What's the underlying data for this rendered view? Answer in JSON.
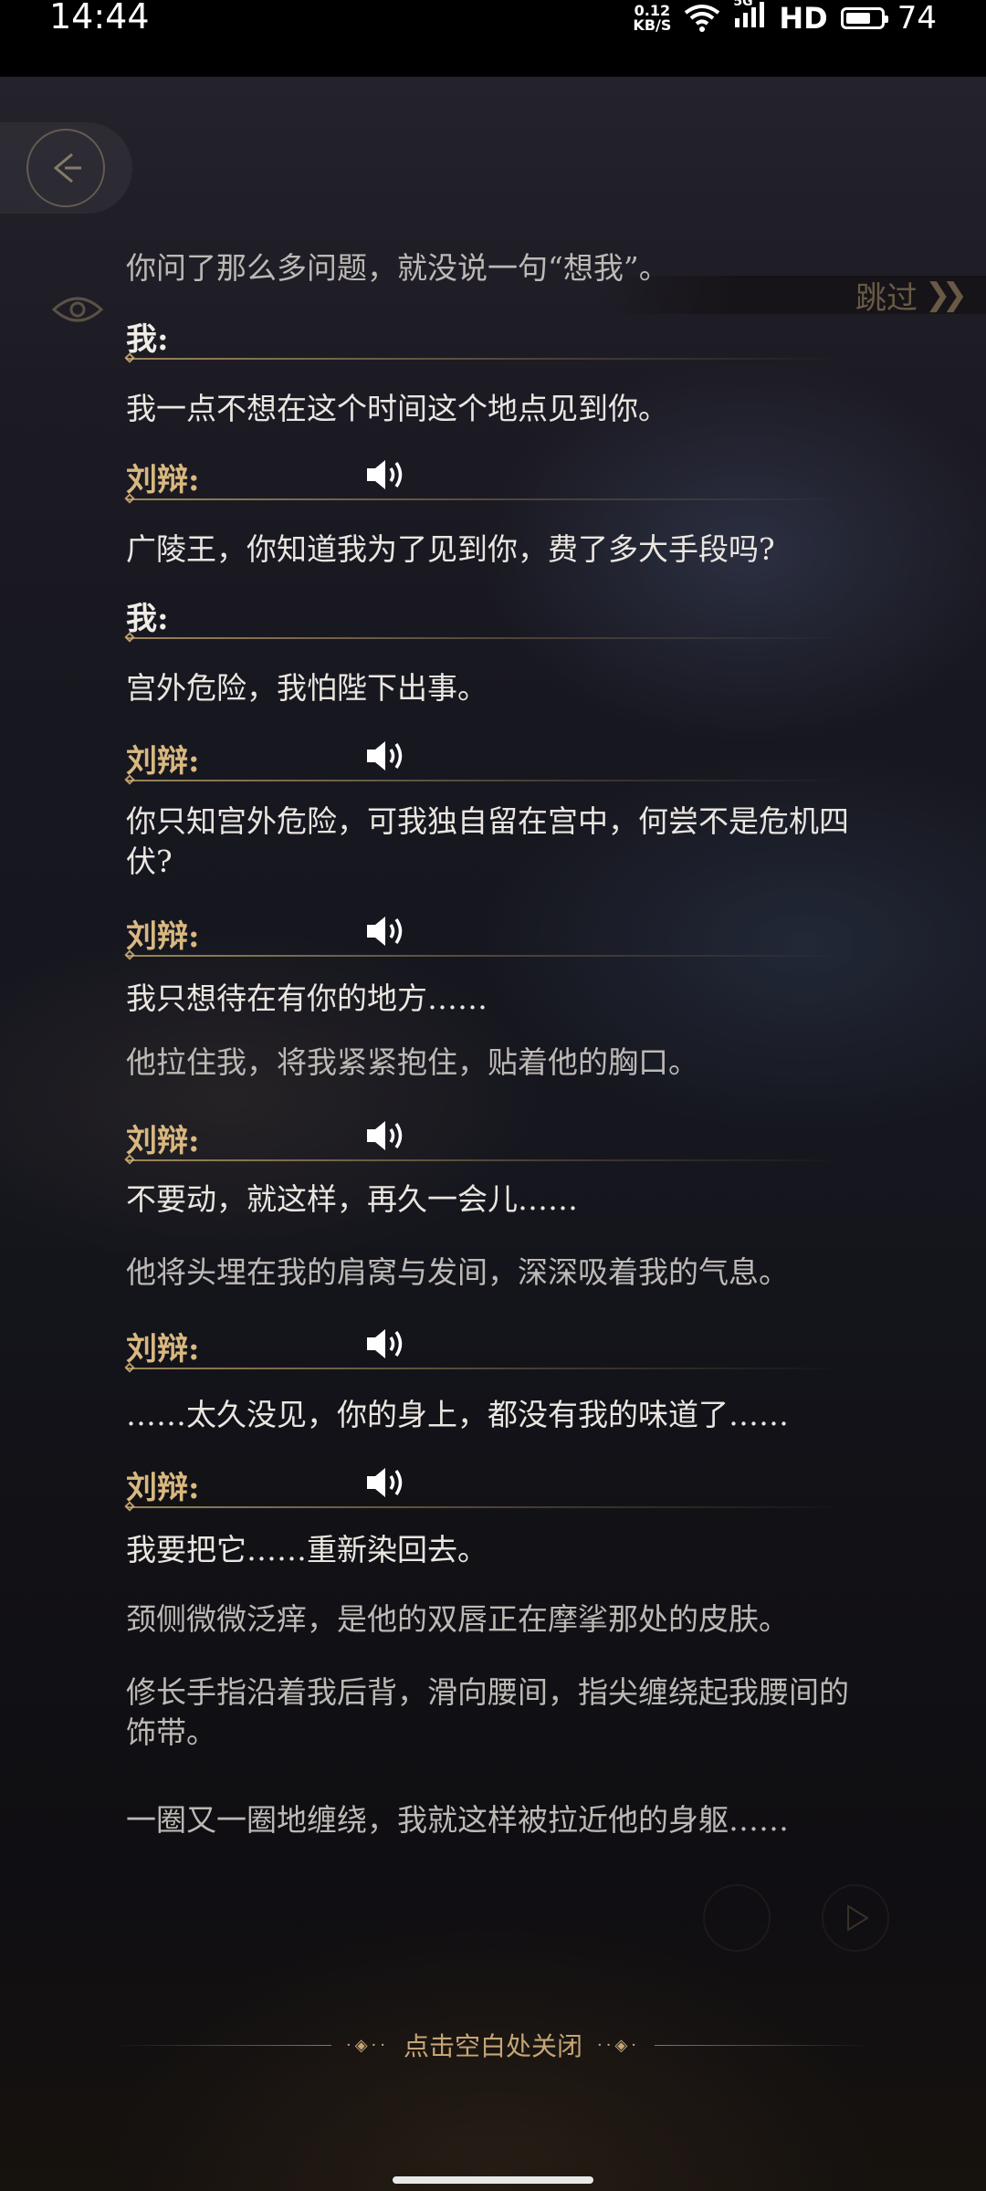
{
  "status_bar": {
    "time": "14:44",
    "net_speed_value": "0.12",
    "net_speed_unit": "KB/S",
    "signal_label": "5G",
    "hd_label": "HD",
    "battery_level": "74",
    "icons": [
      "wifi-icon",
      "cell-signal-icon",
      "battery-icon"
    ]
  },
  "controls": {
    "skip_label": "跳过",
    "close_hint": "点击空白处关闭"
  },
  "dialogue": [
    {
      "type": "narration",
      "text": "你问了那么多问题，就没说一句“想我”。"
    },
    {
      "type": "speaker",
      "name": "我:",
      "side": "me",
      "voice": false
    },
    {
      "type": "line",
      "text": "我一点不想在这个时间这个地点见到你。"
    },
    {
      "type": "speaker",
      "name": "刘辩:",
      "side": "npc",
      "voice": true
    },
    {
      "type": "line",
      "text": "广陵王，你知道我为了见到你，费了多大手段吗?"
    },
    {
      "type": "speaker",
      "name": "我:",
      "side": "me",
      "voice": false
    },
    {
      "type": "line",
      "text": "宫外危险，我怕陛下出事。"
    },
    {
      "type": "speaker",
      "name": "刘辩:",
      "side": "npc",
      "voice": true
    },
    {
      "type": "line",
      "text": "你只知宫外危险，可我独自留在宫中，何尝不是危机四伏?"
    },
    {
      "type": "speaker",
      "name": "刘辩:",
      "side": "npc",
      "voice": true
    },
    {
      "type": "line",
      "text": "我只想待在有你的地方……"
    },
    {
      "type": "narration",
      "text": "他拉住我，将我紧紧抱住，贴着他的胸口。"
    },
    {
      "type": "speaker",
      "name": "刘辩:",
      "side": "npc",
      "voice": true
    },
    {
      "type": "line",
      "text": "不要动，就这样，再久一会儿……"
    },
    {
      "type": "narration",
      "text": "他将头埋在我的肩窝与发间，深深吸着我的气息。"
    },
    {
      "type": "speaker",
      "name": "刘辩:",
      "side": "npc",
      "voice": true
    },
    {
      "type": "line",
      "text": "……太久没见，你的身上，都没有我的味道了……"
    },
    {
      "type": "speaker",
      "name": "刘辩:",
      "side": "npc",
      "voice": true
    },
    {
      "type": "line",
      "text": "我要把它……重新染回去。"
    },
    {
      "type": "narration",
      "text": "颈侧微微泛痒，是他的双唇正在摩挲那处的皮肤。"
    },
    {
      "type": "narration",
      "text": "修长手指沿着我后背，滑向腰间，指尖缠绕起我腰间的饰带。"
    },
    {
      "type": "narration",
      "text": "一圈又一圈地缠绕，我就这样被拉近他的身躯……"
    }
  ]
}
